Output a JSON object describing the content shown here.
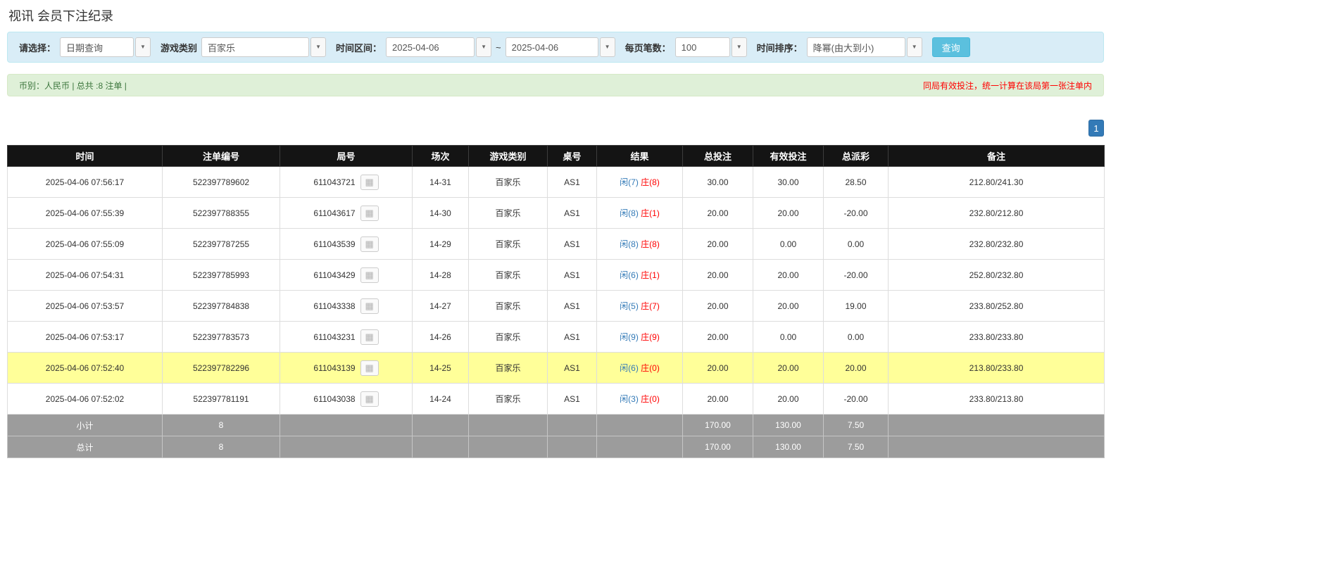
{
  "page": {
    "title": "视讯 会员下注纪录"
  },
  "colors": {
    "filter_bar_bg": "#d9edf7",
    "summary_bar_bg": "#dff0d8",
    "notice_red": "#ff0000",
    "search_button_bg": "#5bc0de",
    "pagination_active_bg": "#337ab7",
    "table_header_bg": "#141414",
    "table_footer_bg": "#9c9c9c",
    "highlight_row_bg": "#ffff99",
    "player_blue": "#337ab7",
    "banker_red": "#ff0000",
    "negative_red": "#ff0000"
  },
  "icons": {
    "caret": "▼",
    "cards": "▦"
  },
  "filters": {
    "select_label": "请选择：",
    "select_value": "日期查询",
    "game_type_label": "游戏类别",
    "game_type_value": "百家乐",
    "date_range_label": "时间区间：",
    "date_from": "2025-04-06",
    "date_separator": "~",
    "date_to": "2025-04-06",
    "page_size_label": "每页笔数：",
    "page_size_value": "100",
    "sort_label": "时间排序：",
    "sort_value": "降幂(由大到小)",
    "search_button": "查询"
  },
  "summary_bar": {
    "left_text": "币别：人民币 | 总共 :8 注单 |",
    "right_text": "同局有效投注，统一计算在该局第一张注单内"
  },
  "pagination": {
    "current_page": "1"
  },
  "table": {
    "headers": [
      "时间",
      "注单编号",
      "局号",
      "场次",
      "游戏类别",
      "桌号",
      "结果",
      "总投注",
      "有效投注",
      "总派彩",
      "备注"
    ],
    "rows": [
      {
        "time": "2025-04-06 07:56:17",
        "bet_id": "522397789602",
        "round_id": "611043721",
        "session": "14-31",
        "game": "百家乐",
        "table_no": "AS1",
        "result_player": "闲(7)",
        "result_banker": "庄(8)",
        "total_bet": "30.00",
        "valid_bet": "30.00",
        "payout": "28.50",
        "remark": "212.80/241.30",
        "highlight": false
      },
      {
        "time": "2025-04-06 07:55:39",
        "bet_id": "522397788355",
        "round_id": "611043617",
        "session": "14-30",
        "game": "百家乐",
        "table_no": "AS1",
        "result_player": "闲(8)",
        "result_banker": "庄(1)",
        "total_bet": "20.00",
        "valid_bet": "20.00",
        "payout": "-20.00",
        "remark": "232.80/212.80",
        "highlight": false
      },
      {
        "time": "2025-04-06 07:55:09",
        "bet_id": "522397787255",
        "round_id": "611043539",
        "session": "14-29",
        "game": "百家乐",
        "table_no": "AS1",
        "result_player": "闲(8)",
        "result_banker": "庄(8)",
        "total_bet": "20.00",
        "valid_bet": "0.00",
        "payout": "0.00",
        "remark": "232.80/232.80",
        "highlight": false
      },
      {
        "time": "2025-04-06 07:54:31",
        "bet_id": "522397785993",
        "round_id": "611043429",
        "session": "14-28",
        "game": "百家乐",
        "table_no": "AS1",
        "result_player": "闲(6)",
        "result_banker": "庄(1)",
        "total_bet": "20.00",
        "valid_bet": "20.00",
        "payout": "-20.00",
        "remark": "252.80/232.80",
        "highlight": false
      },
      {
        "time": "2025-04-06 07:53:57",
        "bet_id": "522397784838",
        "round_id": "611043338",
        "session": "14-27",
        "game": "百家乐",
        "table_no": "AS1",
        "result_player": "闲(5)",
        "result_banker": "庄(7)",
        "total_bet": "20.00",
        "valid_bet": "20.00",
        "payout": "19.00",
        "remark": "233.80/252.80",
        "highlight": false
      },
      {
        "time": "2025-04-06 07:53:17",
        "bet_id": "522397783573",
        "round_id": "611043231",
        "session": "14-26",
        "game": "百家乐",
        "table_no": "AS1",
        "result_player": "闲(9)",
        "result_banker": "庄(9)",
        "total_bet": "20.00",
        "valid_bet": "0.00",
        "payout": "0.00",
        "remark": "233.80/233.80",
        "highlight": false
      },
      {
        "time": "2025-04-06 07:52:40",
        "bet_id": "522397782296",
        "round_id": "611043139",
        "session": "14-25",
        "game": "百家乐",
        "table_no": "AS1",
        "result_player": "闲(6)",
        "result_banker": "庄(0)",
        "total_bet": "20.00",
        "valid_bet": "20.00",
        "payout": "20.00",
        "remark": "213.80/233.80",
        "highlight": true
      },
      {
        "time": "2025-04-06 07:52:02",
        "bet_id": "522397781191",
        "round_id": "611043038",
        "session": "14-24",
        "game": "百家乐",
        "table_no": "AS1",
        "result_player": "闲(3)",
        "result_banker": "庄(0)",
        "total_bet": "20.00",
        "valid_bet": "20.00",
        "payout": "-20.00",
        "remark": "233.80/213.80",
        "highlight": false
      }
    ],
    "footer": [
      {
        "label": "小计",
        "count": "8",
        "total_bet": "170.00",
        "valid_bet": "130.00",
        "payout": "7.50"
      },
      {
        "label": "总计",
        "count": "8",
        "total_bet": "170.00",
        "valid_bet": "130.00",
        "payout": "7.50"
      }
    ]
  }
}
